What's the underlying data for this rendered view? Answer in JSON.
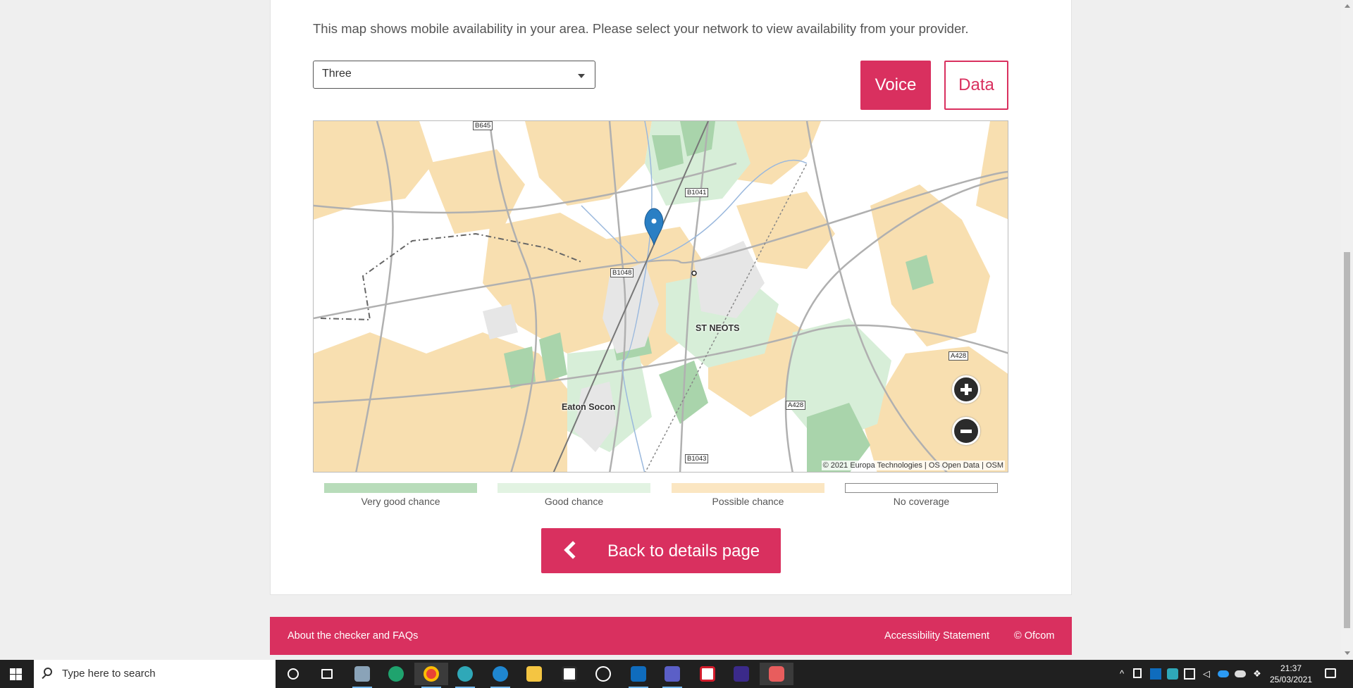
{
  "page": {
    "intro": "This map shows mobile availability in your area. Please select your network to view availability from your provider.",
    "network_select": {
      "selected": "Three"
    },
    "mode_toggle": {
      "voice_label": "Voice",
      "data_label": "Data",
      "active": "Voice"
    },
    "map": {
      "places": {
        "st_neots": "ST NEOTS",
        "eaton_socon": "Eaton Socon"
      },
      "roads": {
        "b645": "B645",
        "b1041": "B1041",
        "b1048": "B1048",
        "a428_east": "A428",
        "a428_south": "A428",
        "b1043": "B1043"
      },
      "attribution": "© 2021 Europa Technologies | OS Open Data | OSM",
      "colors": {
        "very_good": "#a9d4ab",
        "good": "#d7eed8",
        "possible": "#f8dfb0",
        "none": "#ffffff",
        "marker": "#2a7fc4"
      }
    },
    "legend": [
      {
        "label": "Very good chance",
        "color": "#b8dcba"
      },
      {
        "label": "Good chance",
        "color": "#e2f3e2"
      },
      {
        "label": "Possible chance",
        "color": "#fbe6c2"
      },
      {
        "label": "No coverage",
        "color": "#ffffff"
      }
    ],
    "back_button": "Back to details page"
  },
  "footer": {
    "about": "About the checker and FAQs",
    "accessibility": "Accessibility Statement",
    "copyright": "© Ofcom"
  },
  "taskbar": {
    "search_placeholder": "Type here to search",
    "time": "21:37",
    "date": "25/03/2021"
  }
}
